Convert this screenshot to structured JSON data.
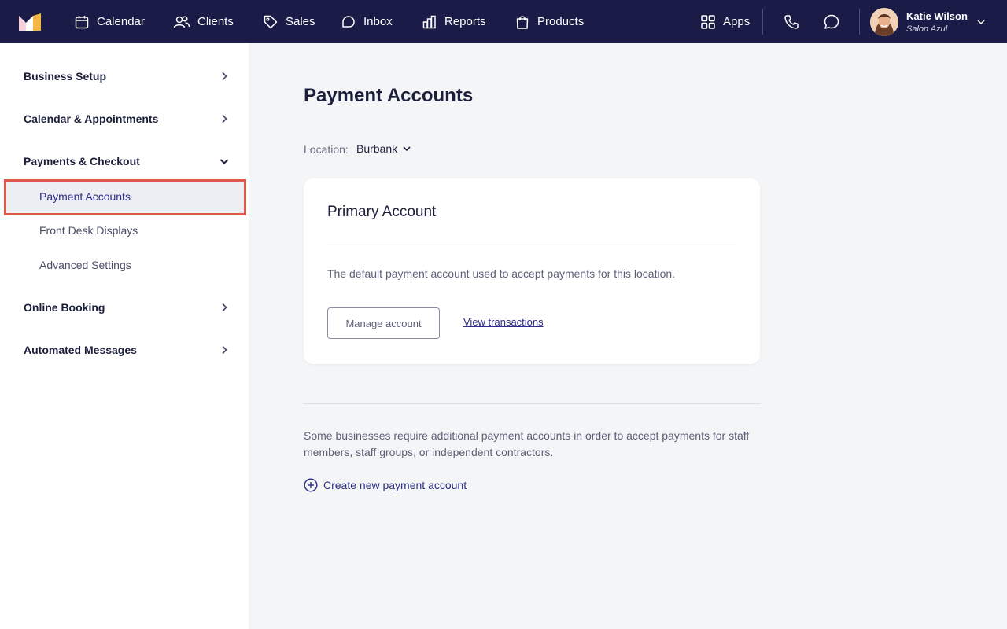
{
  "nav": {
    "items": [
      {
        "label": "Calendar",
        "icon": "calendar-icon"
      },
      {
        "label": "Clients",
        "icon": "users-icon"
      },
      {
        "label": "Sales",
        "icon": "tag-icon"
      },
      {
        "label": "Inbox",
        "icon": "inbox-icon"
      },
      {
        "label": "Reports",
        "icon": "bar-chart-icon"
      },
      {
        "label": "Products",
        "icon": "shopping-bag-icon"
      }
    ],
    "apps_label": "Apps",
    "user": {
      "name": "Katie Wilson",
      "business": "Salon Azul"
    }
  },
  "sidebar": {
    "sections": [
      {
        "label": "Business Setup",
        "expanded": false
      },
      {
        "label": "Calendar & Appointments",
        "expanded": false
      },
      {
        "label": "Payments & Checkout",
        "expanded": true
      },
      {
        "label": "Online Booking",
        "expanded": false
      },
      {
        "label": "Automated Messages",
        "expanded": false
      }
    ],
    "payments_items": [
      {
        "label": "Payment Accounts",
        "active": true
      },
      {
        "label": "Front Desk Displays",
        "active": false
      },
      {
        "label": "Advanced Settings",
        "active": false
      }
    ]
  },
  "main": {
    "title": "Payment Accounts",
    "location_label": "Location:",
    "location_value": "Burbank",
    "card": {
      "title": "Primary Account",
      "description": "The default payment account used to accept payments for this location.",
      "manage_button": "Manage account",
      "view_link": "View transactions"
    },
    "info_text": "Some businesses require additional payment accounts in order to accept payments for staff members, staff groups, or independent contractors.",
    "create_link": "Create new payment account"
  },
  "colors": {
    "nav_bg": "#1a1c47",
    "page_bg": "#f4f5f7",
    "accent": "#2c2f87",
    "highlight_border": "#e1574a"
  }
}
